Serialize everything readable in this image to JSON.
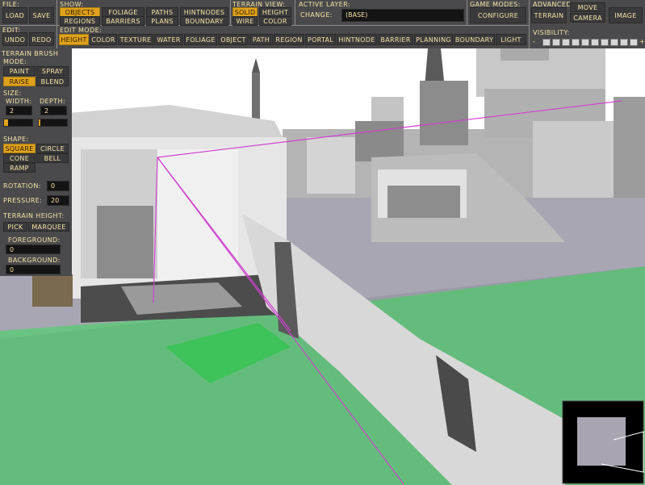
{
  "toolbar": {
    "file": {
      "label": "FILE:",
      "load": "LOAD",
      "save": "SAVE"
    },
    "show": {
      "label": "SHOW:",
      "objects": "OBJECTS",
      "foliage": "FOLIAGE",
      "paths": "PATHS",
      "hintnodes": "HINTNODES",
      "regions": "REGIONS",
      "barriers": "BARRIERS",
      "plans": "PLANS",
      "boundary": "BOUNDARY"
    },
    "terrain_view": {
      "label": "TERRAIN VIEW:",
      "solid": "SOLID",
      "height": "HEIGHT",
      "wire": "WIRE",
      "color": "COLOR"
    },
    "active_layer": {
      "label": "ACTIVE LAYER:",
      "change": "CHANGE:",
      "value": "(BASE)"
    },
    "game_modes": {
      "label": "GAME MODES:",
      "configure": "CONFIGURE"
    },
    "advanced": {
      "label": "ADVANCED",
      "move": "MOVE",
      "terrain": "TERRAIN",
      "camera": "CAMERA",
      "image": "IMAGE"
    },
    "edit": {
      "label": "EDIT:",
      "undo": "UNDO",
      "redo": "REDO"
    },
    "edit_mode": {
      "label": "EDIT MODE:",
      "modes": [
        "HEIGHT",
        "COLOR",
        "TEXTURE",
        "WATER",
        "FOLIAGE",
        "OBJECT",
        "PATH",
        "REGION",
        "PORTAL",
        "HINTNODE",
        "BARRIER",
        "PLANNING",
        "BOUNDARY",
        "LIGHT"
      ],
      "active_index": 0
    },
    "visibility": {
      "label": "VISIBILITY:",
      "minus": "-",
      "plus": "+"
    }
  },
  "brush": {
    "title": "TERRAIN BRUSH",
    "mode_label": "MODE:",
    "paint": "PAINT",
    "spray": "SPRAY",
    "raise": "RAISE",
    "blend": "BLEND",
    "size_label": "SIZE:",
    "width_label": "WIDTH:",
    "depth_label": "DEPTH:",
    "width": "2",
    "depth": "2",
    "width_level": 0.15,
    "depth_level": 0.05,
    "shape_label": "SHAPE:",
    "square": "SQUARE",
    "circle": "CIRCLE",
    "cone": "CONE",
    "bell": "BELL",
    "ramp": "RAMP",
    "rotation_label": "ROTATION:",
    "rotation": "0",
    "pressure_label": "PRESSURE:",
    "pressure": "20",
    "terrain_height_label": "TERRAIN HEIGHT:",
    "pick": "PICK",
    "marquee": "MARQUEE",
    "foreground_label": "FOREGROUND:",
    "foreground": "0",
    "background_label": "BACKGROUND:",
    "background": "0"
  },
  "colors": {
    "accent": "#e0a21c",
    "panel": "#4a4a4c",
    "text": "#f4e3a4",
    "grid_overlay": "#22e64a",
    "selection_line": "#d040d0"
  }
}
